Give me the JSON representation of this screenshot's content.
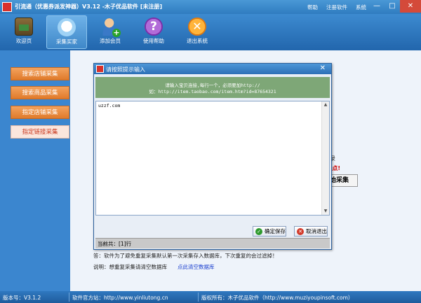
{
  "window": {
    "title": "引流通（优惠券派发神器）V3.12 -木子优品软件 [未注册]",
    "links": [
      "帮助",
      "注册软件",
      "系统"
    ],
    "controls": {
      "minimize": "—",
      "maximize": "□",
      "close": "✕"
    }
  },
  "toolbar": [
    {
      "label": "欢迎页",
      "icon": "home-icon"
    },
    {
      "label": "采集买家",
      "icon": "collect-icon"
    },
    {
      "label": "添加会员",
      "icon": "add-user-icon"
    },
    {
      "label": "使用帮助",
      "icon": "help-icon",
      "glyph": "?"
    },
    {
      "label": "退出系统",
      "icon": "exit-icon",
      "glyph": "✕"
    }
  ],
  "sidebar": {
    "items": [
      "搜索店铺采集",
      "搜索商品采集",
      "指定店铺采集",
      "指定链接采集"
    ],
    "active_index": 3
  },
  "main": {
    "text1": "录",
    "text2": "-点!",
    "button": "始采集",
    "answer": "答：软件为了避免重复采集默认第一次采集存入数据库，下次重复的会过滤掉！",
    "note": "说明：想重复采集请清空数据库",
    "link": "点此清空数据库"
  },
  "dialog": {
    "title": "请按照提示输入",
    "close": "✕",
    "hint_line1": "请输入宝贝连接,每行一个，必须要加http://",
    "hint_line2": "如：http://item.taobao.com/item.htm?id=87654321",
    "textarea_value": "uzzf.com",
    "save_label": "确定保存",
    "cancel_label": "取消退出",
    "status": "当前共：[1]行"
  },
  "statusbar": {
    "version": "版本号：V3.1.2",
    "site": "软件官方站：http://www.yinliutong.cn",
    "copyright": "版权所有：木子优品软件（http://www.muziyoupinsoft.com）"
  }
}
